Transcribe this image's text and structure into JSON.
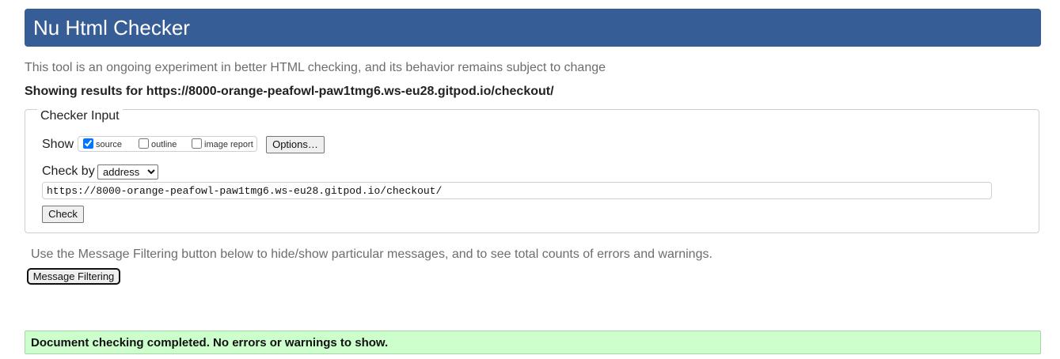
{
  "header": {
    "title": "Nu Html Checker"
  },
  "intro_text": "This tool is an ongoing experiment in better HTML checking, and its behavior remains subject to change",
  "results_for": "Showing results for https://8000-orange-peafowl-paw1tmg6.ws-eu28.gitpod.io/checkout/",
  "checker": {
    "legend": "Checker Input",
    "show_label": "Show",
    "options": [
      {
        "label": "source",
        "checked": true
      },
      {
        "label": "outline",
        "checked": false
      },
      {
        "label": "image report",
        "checked": false
      }
    ],
    "options_button": "Options…",
    "check_by_label": "Check by",
    "check_by_selected": "address",
    "url_value": "https://8000-orange-peafowl-paw1tmg6.ws-eu28.gitpod.io/checkout/",
    "check_button": "Check"
  },
  "filter": {
    "note": "Use the Message Filtering button below to hide/show particular messages, and to see total counts of errors and warnings.",
    "button": "Message Filtering"
  },
  "status": {
    "message": "Document checking completed. No errors or warnings to show.",
    "color": "#ccffcc"
  },
  "colors": {
    "header": "#365d95"
  }
}
